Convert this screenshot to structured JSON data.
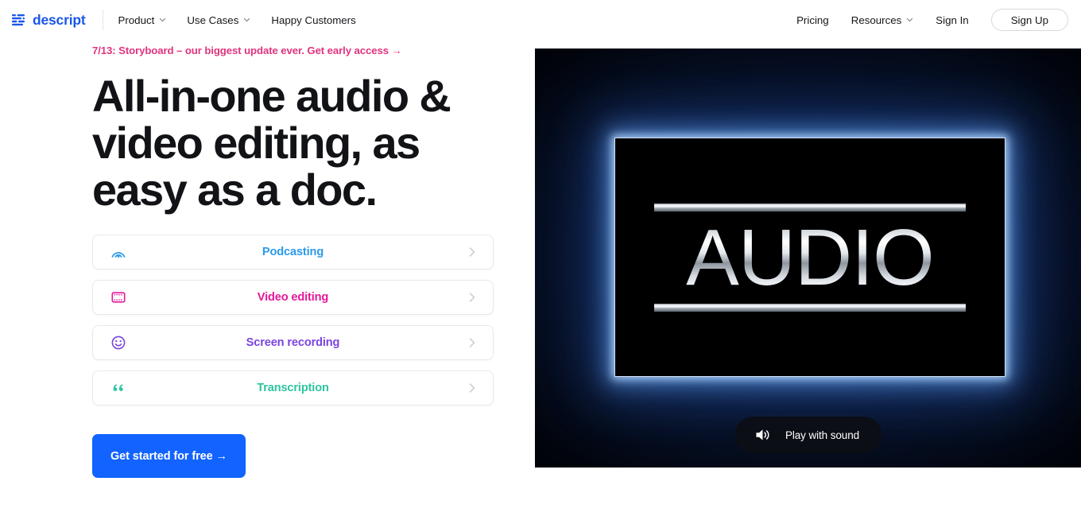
{
  "brand": {
    "logo_text": "descript",
    "logo_icon": "descript-bars-logo-icon",
    "blue": "#1a56e8"
  },
  "nav": {
    "left_items": [
      {
        "label": "Product",
        "has_caret": true
      },
      {
        "label": "Use Cases",
        "has_caret": true
      },
      {
        "label": "Happy Customers",
        "has_caret": false
      }
    ],
    "right_items": [
      {
        "label": "Pricing",
        "has_caret": false
      },
      {
        "label": "Resources",
        "has_caret": true
      },
      {
        "label": "Sign In",
        "has_caret": false
      }
    ],
    "signup_label": "Sign Up"
  },
  "hero": {
    "announcement": "7/13: Storyboard – our biggest update ever. Get early access →",
    "announcement_color": "#e0347f",
    "headline": "All-in-one audio & video editing, as easy as a doc.",
    "cta_label": "Get started for free →",
    "cta_color": "#1263ff"
  },
  "cards": [
    {
      "label": "Podcasting",
      "color": "#2b9ae8",
      "icon": "broadcast-icon",
      "chevron": "chevron-right-icon"
    },
    {
      "label": "Video editing",
      "color": "#e4189a",
      "icon": "film-strip-icon",
      "chevron": "chevron-right-icon"
    },
    {
      "label": "Screen recording",
      "color": "#7b45e0",
      "icon": "smiley-face-icon",
      "chevron": "chevron-right-icon"
    },
    {
      "label": "Transcription",
      "color": "#2ec4a0",
      "icon": "quote-mark-icon",
      "chevron": "chevron-right-icon"
    }
  ],
  "video": {
    "artwork_text": "AUDIO",
    "play_label": "Play with sound",
    "play_icon": "speaker-sound-icon"
  }
}
